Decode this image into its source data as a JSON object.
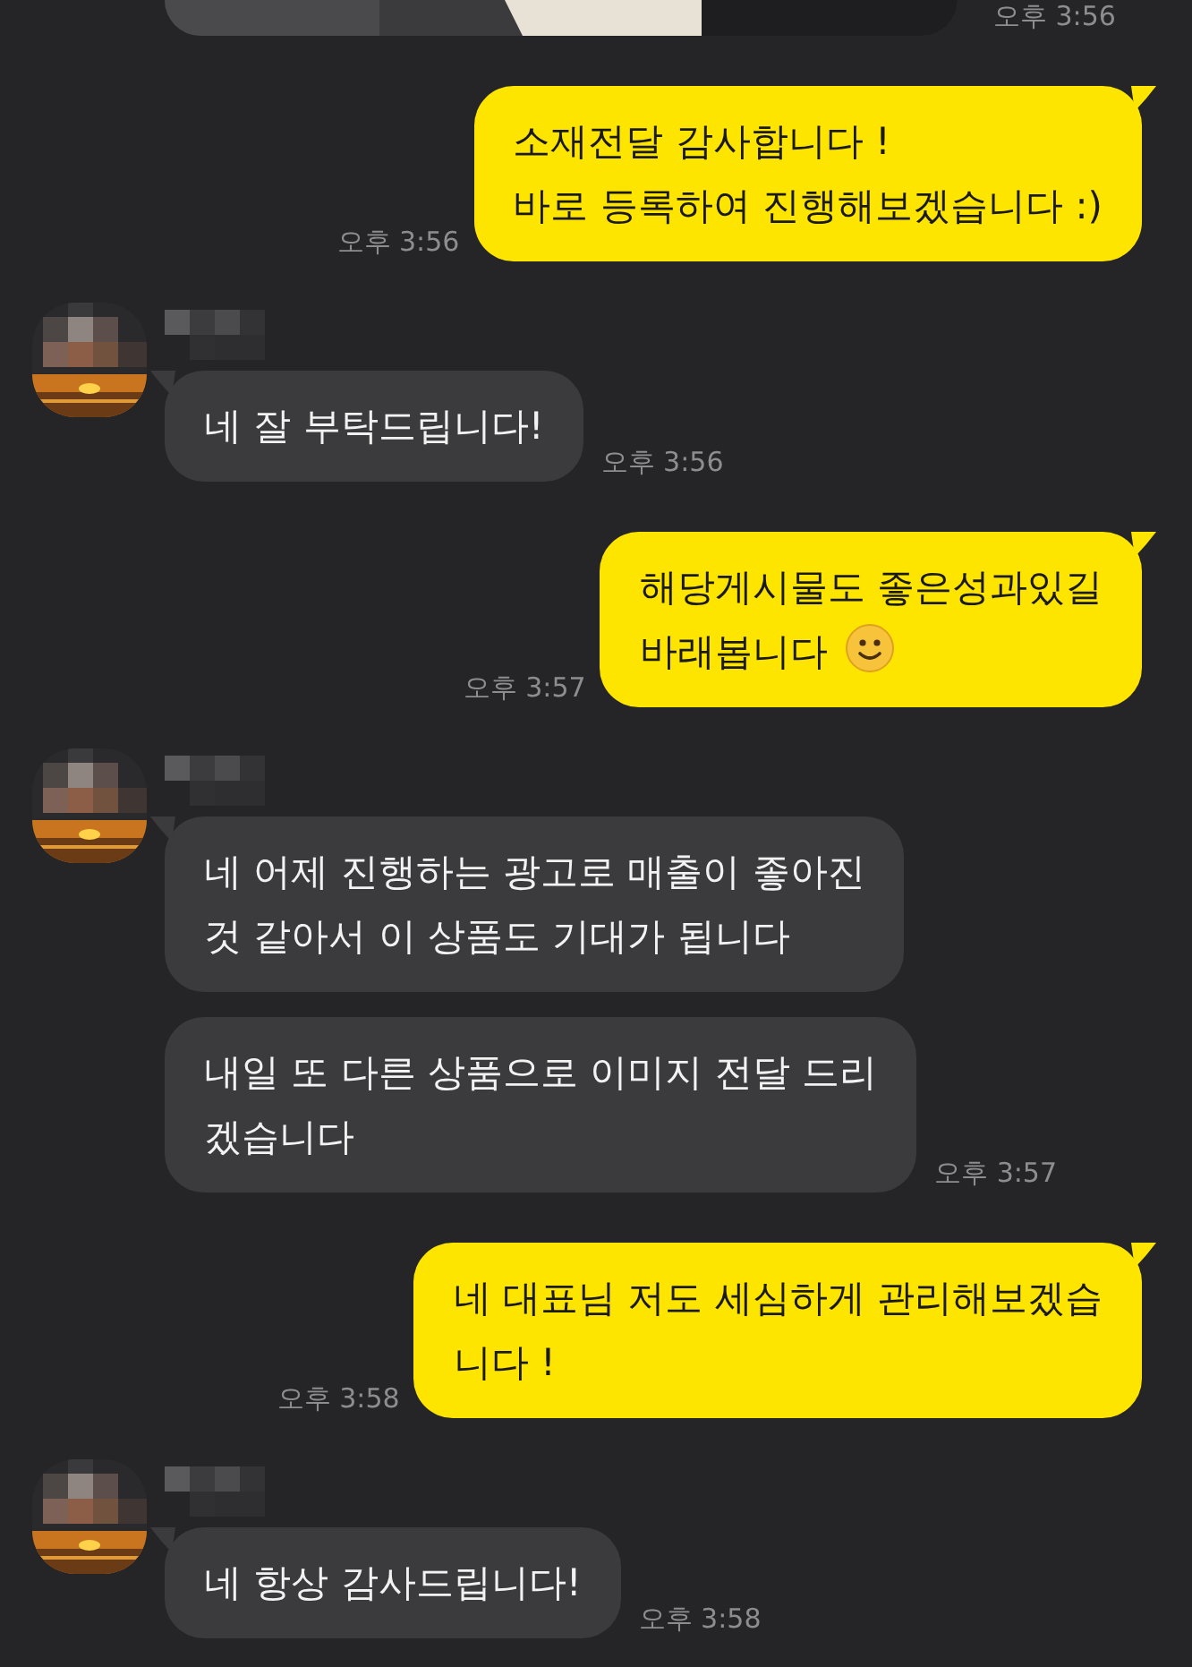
{
  "messages": [
    {
      "time": "오후 3:56"
    },
    {
      "kind": "sent",
      "text": "소재전달 감사합니다 !\n바로 등록하여 진행해보겠습니다 :)",
      "time": "오후 3:56"
    },
    {
      "kind": "received",
      "bubbles": [
        {
          "text": "네 잘 부탁드립니다!",
          "time": "오후 3:56"
        }
      ]
    },
    {
      "kind": "sent",
      "text": "해당게시물도 좋은성과있길\n바래봅니다",
      "has_emoji": true,
      "time": "오후 3:57"
    },
    {
      "kind": "received",
      "bubbles": [
        {
          "text": "네 어제 진행하는 광고로 매출이 좋아진\n것 같아서 이 상품도 기대가 됩니다"
        },
        {
          "text": "내일 또 다른 상품으로 이미지 전달 드리\n겠습니다",
          "time": "오후 3:57"
        }
      ]
    },
    {
      "kind": "sent",
      "text": "네 대표님 저도 세심하게 관리해보겠습\n니다 !",
      "time": "오후 3:58"
    },
    {
      "kind": "received",
      "bubbles": [
        {
          "text": "네 항상 감사드립니다!",
          "time": "오후 3:58"
        }
      ]
    }
  ]
}
